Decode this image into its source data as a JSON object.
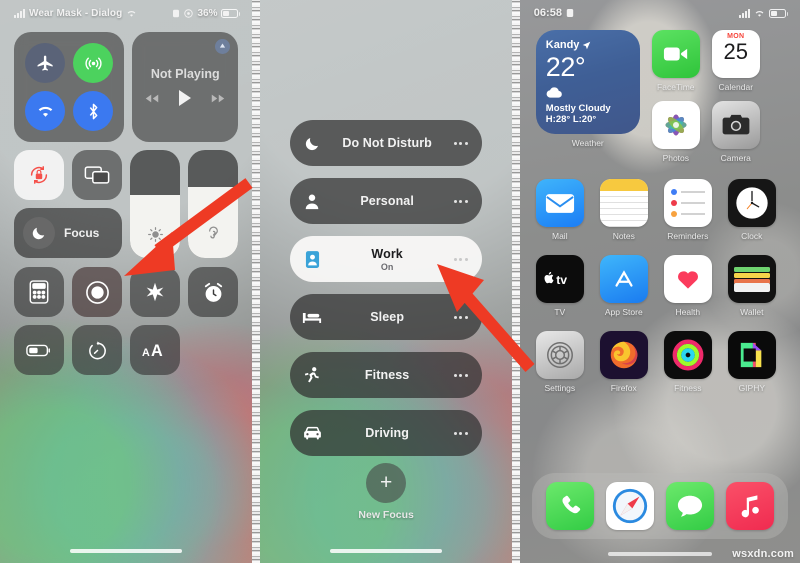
{
  "panel1": {
    "name": "control-center",
    "status_bar": {
      "carrier": "Wear Mask - Dialog",
      "signal_icon": "cellular-bars-icon",
      "wifi_icon": "wifi-icon",
      "alarm_icon": "alarm-icon",
      "location_icon": "location-icon",
      "battery_pct": "36%"
    },
    "connectivity": {
      "airplane": {
        "label": "Airplane Mode",
        "icon": "airplane-icon",
        "state": "off"
      },
      "cellular": {
        "label": "Cellular Data",
        "icon": "cellular-signal-icon",
        "state": "on"
      },
      "wifi": {
        "label": "Wi-Fi",
        "icon": "wifi-icon",
        "state": "on"
      },
      "bluetooth": {
        "label": "Bluetooth",
        "icon": "bluetooth-icon",
        "state": "on"
      }
    },
    "media": {
      "title": "Not Playing",
      "airplay_icon": "airplay-icon",
      "prev_icon": "rewind-icon",
      "play_icon": "play-icon",
      "next_icon": "fast-forward-icon"
    },
    "orientation_lock": {
      "label": "Rotation Lock",
      "icon": "rotation-lock-icon",
      "state": "on"
    },
    "screen_mirroring": {
      "label": "Screen Mirroring",
      "icon": "screen-mirroring-icon"
    },
    "focus_tile": {
      "label": "Focus",
      "icon": "moon-icon"
    },
    "brightness": {
      "label": "Brightness",
      "icon": "brightness-icon",
      "value": 62
    },
    "volume": {
      "label": "Volume",
      "icon": "hearing-icon",
      "value": 70
    },
    "tiles": [
      {
        "label": "Calculator",
        "icon": "calculator-icon"
      },
      {
        "label": "Screen Recording",
        "icon": "record-icon"
      },
      {
        "label": "Shazam",
        "icon": "shazam-icon"
      },
      {
        "label": "Alarm",
        "icon": "alarm-clock-icon"
      },
      {
        "label": "Low Power Mode",
        "icon": "battery-icon"
      },
      {
        "label": "Timer",
        "icon": "timer-icon"
      },
      {
        "label": "Text Size",
        "icon": "text-size-icon"
      }
    ]
  },
  "panel2": {
    "name": "focus-list",
    "items": [
      {
        "label": "Do Not Disturb",
        "icon": "moon-icon",
        "state": "",
        "active": false
      },
      {
        "label": "Personal",
        "icon": "person-icon",
        "state": "",
        "active": false
      },
      {
        "label": "Work",
        "icon": "id-card-icon",
        "state": "On",
        "active": true
      },
      {
        "label": "Sleep",
        "icon": "bed-icon",
        "state": "",
        "active": false
      },
      {
        "label": "Fitness",
        "icon": "running-icon",
        "state": "",
        "active": false
      },
      {
        "label": "Driving",
        "icon": "car-icon",
        "state": "",
        "active": false
      }
    ],
    "more_icon": "ellipsis-icon",
    "new_focus": {
      "label": "New Focus",
      "icon": "plus-icon"
    }
  },
  "panel3": {
    "name": "home-screen",
    "status_bar": {
      "time": "06:58",
      "alarm_icon": "alarm-icon",
      "signal_icon": "cellular-bars-icon",
      "wifi_icon": "wifi-icon",
      "battery_icon": "battery-icon"
    },
    "weather_widget": {
      "city": "Kandy",
      "location_icon": "location-arrow-icon",
      "temp": "22°",
      "condition_icon": "cloud-icon",
      "condition": "Mostly Cloudy",
      "high_low": "H:28° L:20°",
      "label": "Weather"
    },
    "apps_top": [
      {
        "label": "FaceTime",
        "icon": "facetime-icon"
      },
      {
        "label": "Calendar",
        "icon": "calendar-icon",
        "day_name": "MON",
        "day_number": "25"
      },
      {
        "label": "Photos",
        "icon": "photos-icon"
      },
      {
        "label": "Camera",
        "icon": "camera-icon"
      }
    ],
    "apps_grid": [
      {
        "label": "Mail",
        "icon": "mail-icon"
      },
      {
        "label": "Notes",
        "icon": "notes-icon"
      },
      {
        "label": "Reminders",
        "icon": "reminders-icon"
      },
      {
        "label": "Clock",
        "icon": "clock-icon"
      },
      {
        "label": "TV",
        "icon": "apple-tv-icon"
      },
      {
        "label": "App Store",
        "icon": "app-store-icon"
      },
      {
        "label": "Health",
        "icon": "health-icon"
      },
      {
        "label": "Wallet",
        "icon": "wallet-icon"
      },
      {
        "label": "Settings",
        "icon": "settings-gear-icon"
      },
      {
        "label": "Firefox",
        "icon": "firefox-icon"
      },
      {
        "label": "Fitness",
        "icon": "fitness-rings-icon"
      },
      {
        "label": "GIPHY",
        "icon": "giphy-icon"
      }
    ],
    "dock": [
      {
        "label": "Phone",
        "icon": "phone-icon"
      },
      {
        "label": "Safari",
        "icon": "safari-icon"
      },
      {
        "label": "Messages",
        "icon": "messages-icon"
      },
      {
        "label": "Music",
        "icon": "music-icon"
      }
    ]
  },
  "annotations": {
    "arrow_color": "#ee3a24",
    "arrow1_target": "Focus tile in Control Center",
    "arrow2_target": "Work focus row"
  },
  "watermark": "wsxdn.com"
}
